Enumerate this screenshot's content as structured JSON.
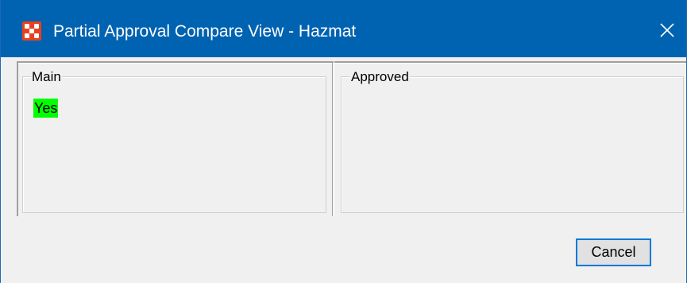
{
  "window": {
    "title": "Partial Approval Compare View - Hazmat",
    "close_icon": "close-icon",
    "app_icon": "app-logo-icon",
    "titlebar_color": "#0063b1"
  },
  "panels": {
    "main": {
      "label": "Main",
      "value": "Yes",
      "value_highlight": "#00ff00"
    },
    "approved": {
      "label": "Approved",
      "value": ""
    }
  },
  "actions": {
    "cancel_label": "Cancel"
  }
}
